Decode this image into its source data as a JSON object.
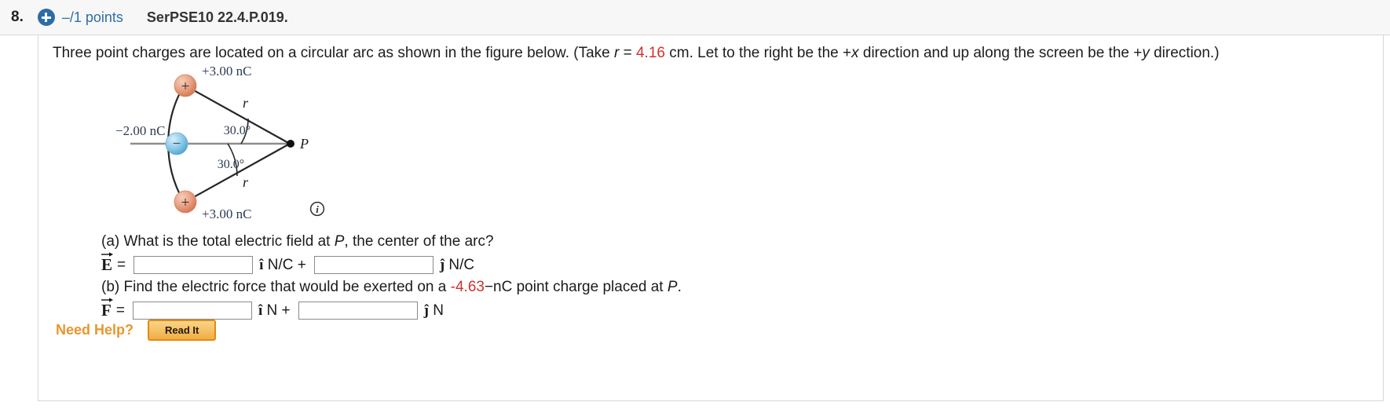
{
  "header": {
    "question_number": "8.",
    "plus_icon": "plus-circle-icon",
    "points": "–/1 points",
    "question_code": "SerPSE10 22.4.P.019."
  },
  "prompt": {
    "part1": "Three point charges are located on a circular arc as shown in the figure below. (Take ",
    "var_r": "r",
    "equals": " = ",
    "r_value": "4.16",
    "part2": " cm. Let to the right be the +",
    "var_x": "x",
    "part3": " direction and up along the screen be the +",
    "var_y": "y",
    "part4": " direction.)"
  },
  "figure": {
    "top_charge_label": "+3.00 nC",
    "left_charge_label": "−2.00 nC",
    "bottom_charge_label": "+3.00 nC",
    "radius_label_top": "r",
    "radius_label_bottom": "r",
    "angle_top": "30.0°",
    "angle_bottom": "30.0°",
    "point_label": "P",
    "positive_sign": "+",
    "negative_sign": "−",
    "info_icon": "info-icon",
    "colors": {
      "positive_charge": "#e08b6b",
      "negative_charge": "#7fc3e8",
      "axis_line": "#8a8a8a",
      "arc_line": "#2b2b2b",
      "label_text": "#2b3a55"
    }
  },
  "part_a": {
    "question": "(a) What is the total electric field at P, the center of the arc?",
    "question_pre": "(a) What is the total electric field at ",
    "question_var": "P",
    "question_post": ", the center of the arc?",
    "vector_symbol": "E",
    "equals": "=",
    "x_value": "",
    "y_value": "",
    "x_placeholder": "",
    "y_placeholder": "",
    "x_unit_hat": "î",
    "x_unit": "N/C",
    "plus": "+",
    "y_unit_hat": "ĵ",
    "y_unit": "N/C"
  },
  "part_b": {
    "question_pre": "(b) Find the electric force that would be exerted on a ",
    "charge_value": "-4.63",
    "question_mid": "−nC point charge placed at ",
    "question_var": "P",
    "question_post": ".",
    "vector_symbol": "F",
    "equals": "=",
    "x_value": "",
    "y_value": "",
    "x_placeholder": "",
    "y_placeholder": "",
    "x_unit_hat": "î",
    "x_unit": "N",
    "plus": "+",
    "y_unit_hat": "ĵ",
    "y_unit": "N"
  },
  "help": {
    "label": "Need Help?",
    "read_it_button": "Read It"
  }
}
